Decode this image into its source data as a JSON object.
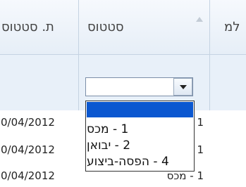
{
  "columns": [
    {
      "label": "ת. סטטוס"
    },
    {
      "label": "סטטוס",
      "sorted": "ascending"
    },
    {
      "label": "למ"
    }
  ],
  "status_filter": {
    "selected_value": "",
    "options": [
      {
        "label": ""
      },
      {
        "label": "1 - מכס"
      },
      {
        "label": "2 - יבואן"
      },
      {
        "label": "4 - הפסה-ביצוע"
      }
    ]
  },
  "rows": [
    {
      "date": "0/04/2012",
      "status": "1"
    },
    {
      "date": "0/04/2012",
      "status": "1"
    },
    {
      "date": "0/04/2012",
      "status": "1 - מכס"
    }
  ],
  "colors": {
    "header_bg": "#eef3f9",
    "filter_bg": "#e8f0f9",
    "border": "#c5d3e2",
    "selected_option_bg": "#0b57d0"
  }
}
